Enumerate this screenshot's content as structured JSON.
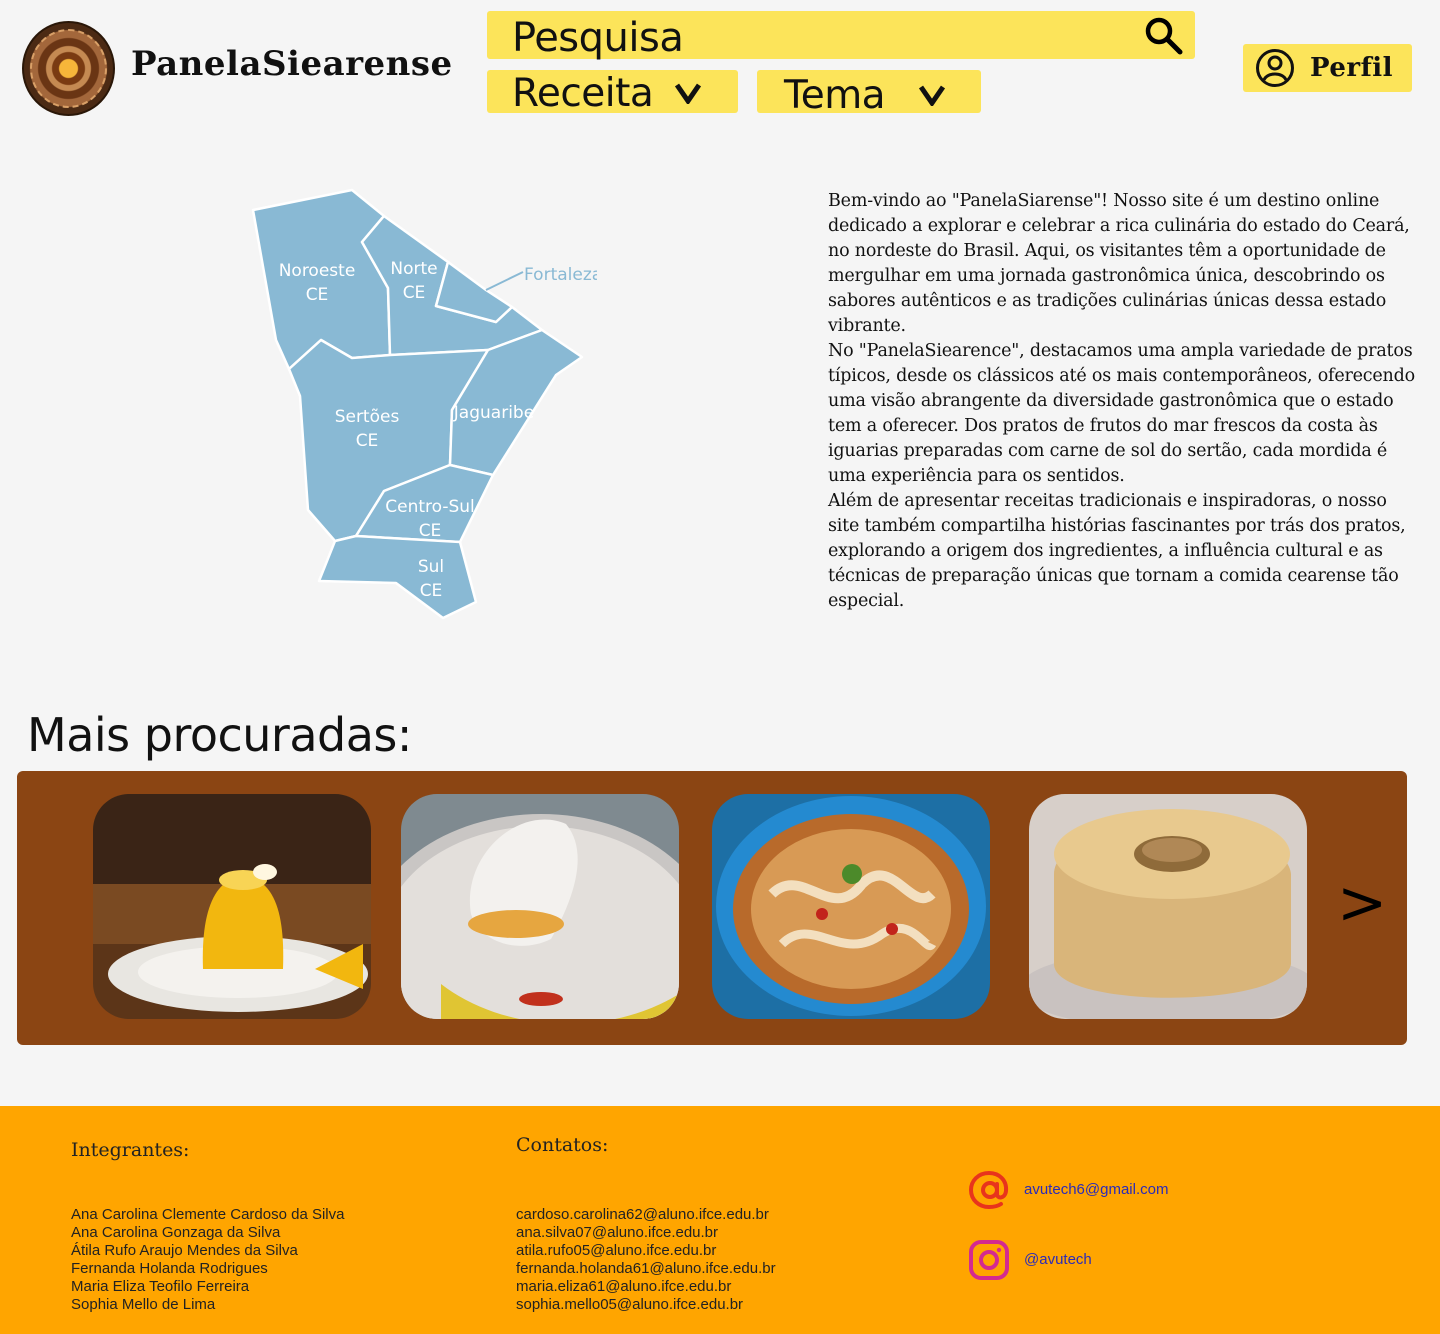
{
  "header": {
    "brand": "PanelaSiearense",
    "search_placeholder": "Pesquisa",
    "dropdown_receita": "Receita",
    "dropdown_tema": "Tema",
    "profile_label": "Perfil"
  },
  "map": {
    "regions": {
      "noroeste": [
        "Noroeste",
        "CE"
      ],
      "norte": [
        "Norte",
        "CE"
      ],
      "fortaleza": "Fortaleza",
      "sertoes": [
        "Sertões",
        "CE"
      ],
      "jaguaribe": "Jaguaribe",
      "centro_sul": [
        "Centro-Sul",
        "CE"
      ],
      "sul": [
        "Sul",
        "CE"
      ]
    },
    "color": "#89b9d4"
  },
  "intro": {
    "p1": "Bem-vindo ao \"PanelaSiarense\"! Nosso site é um destino online dedicado a explorar e celebrar a rica culinária do estado do Ceará, no nordeste do Brasil. Aqui, os visitantes têm a oportunidade de mergulhar em uma jornada gastronômica única, descobrindo os sabores autênticos e as tradições culinárias únicas dessa estado vibrante.",
    "p2": "No \"PanelaSiearence\", destacamos uma ampla variedade de pratos típicos, desde os clássicos até os mais contemporâneos, oferecendo uma visão abrangente da diversidade gastronômica que o estado tem a oferecer. Dos pratos de frutos do mar frescos da costa às iguarias preparadas com carne de sol do sertão, cada mordida é uma experiência para os sentidos.",
    "p3": "Além de apresentar receitas tradicionais e inspiradoras, o nosso site também compartilha histórias fascinantes por trás dos pratos, explorando a origem dos ingredientes, a influência cultural e as técnicas de preparação únicas que tornam a comida cearense tão especial."
  },
  "popular": {
    "title": "Mais procuradas:",
    "next": ">",
    "colors": {
      "background": "#8b4513"
    }
  },
  "footer": {
    "integrantes_heading": "Integrantes:",
    "contatos_heading": "Contatos:",
    "names": [
      "Ana Carolina Clemente Cardoso da Silva",
      "Ana Carolina Gonzaga da Silva",
      "Átila Rufo Araujo Mendes da Silva",
      "Fernanda Holanda Rodrigues",
      "Maria Eliza Teofilo Ferreira",
      "Sophia Mello de Lima"
    ],
    "emails": [
      "cardoso.carolina62@aluno.ifce.edu.br",
      "ana.silva07@aluno.ifce.edu.br",
      "atila.rufo05@aluno.ifce.edu.br",
      "fernanda.holanda61@aluno.ifce.edu.br",
      "maria.eliza61@aluno.ifce.edu.br",
      "sophia.mello05@aluno.ifce.edu.br"
    ],
    "contact_email": "avutech6@gmail.com",
    "instagram": "@avutech",
    "colors": {
      "background": "#ffa500",
      "link": "#2b2bb8"
    }
  },
  "colors": {
    "accent_yellow": "#fce45a",
    "page_bg": "#f5f5f5"
  }
}
